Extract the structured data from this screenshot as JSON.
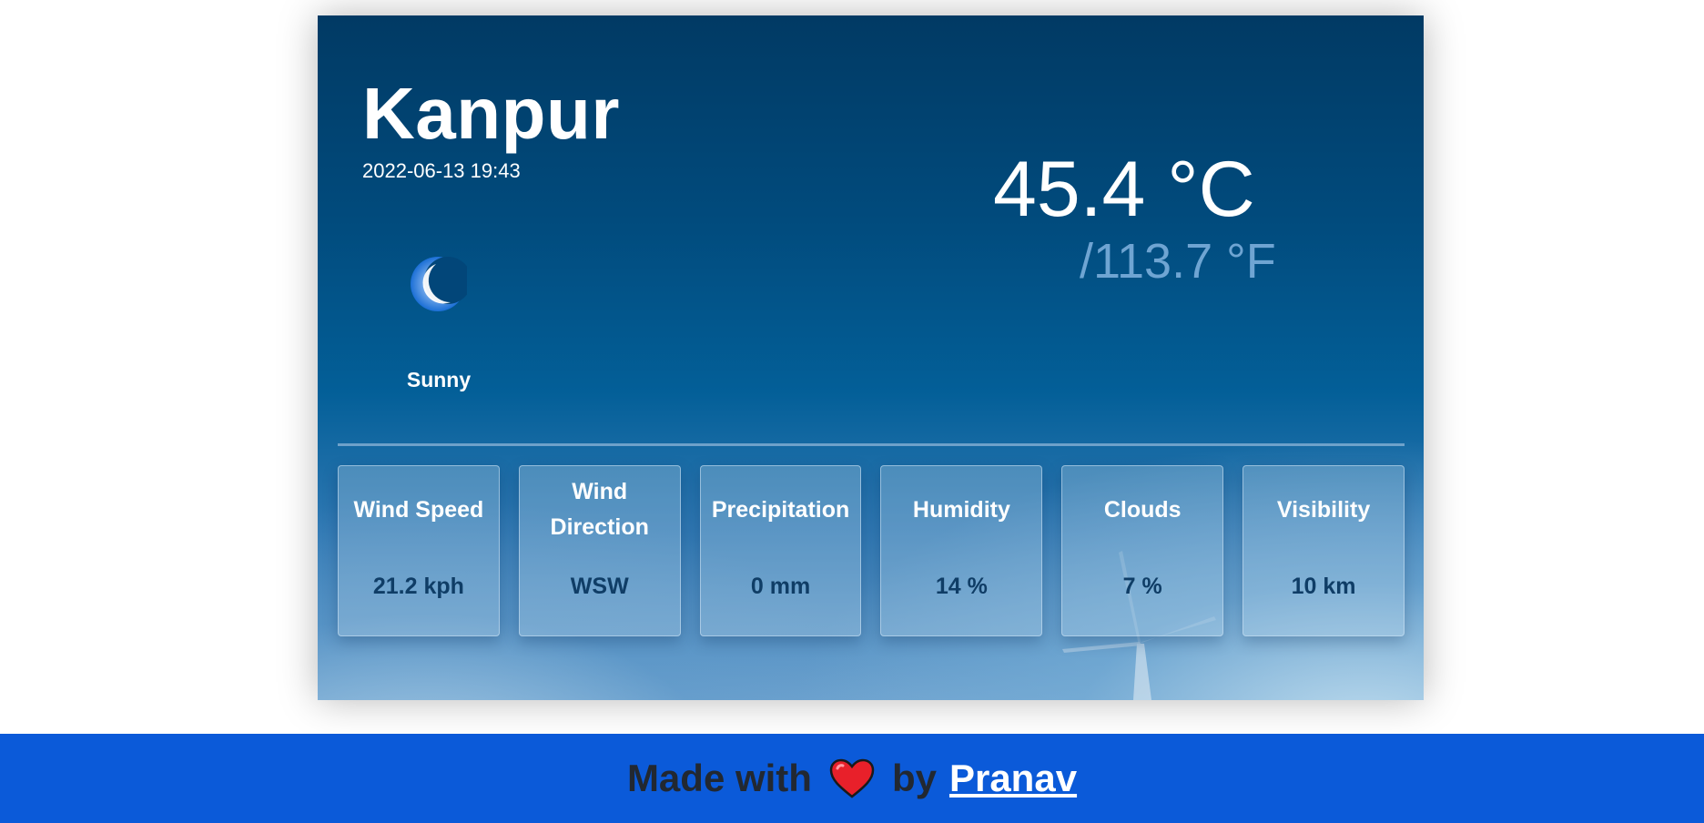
{
  "weather": {
    "city": "Kanpur",
    "datetime": "2022-06-13 19:43",
    "condition": "Sunny",
    "condition_icon": "moon-icon",
    "temp_c": "45.4 °C",
    "temp_f": "/113.7 °F"
  },
  "metrics": [
    {
      "label": "Wind Speed",
      "value": "21.2 kph"
    },
    {
      "label": "Wind Direction",
      "value": "WSW"
    },
    {
      "label": "Precipitation",
      "value": "0 mm"
    },
    {
      "label": "Humidity",
      "value": "14 %"
    },
    {
      "label": "Clouds",
      "value": "7 %"
    },
    {
      "label": "Visibility",
      "value": "10 km"
    }
  ],
  "footer": {
    "made_with": "Made with",
    "heart_icon": "heart-icon",
    "by": "by",
    "author": "Pranav"
  },
  "colors": {
    "footer_bg": "#0b5ad9",
    "card_top": "#013a64",
    "metric_value": "#0f3d66"
  }
}
